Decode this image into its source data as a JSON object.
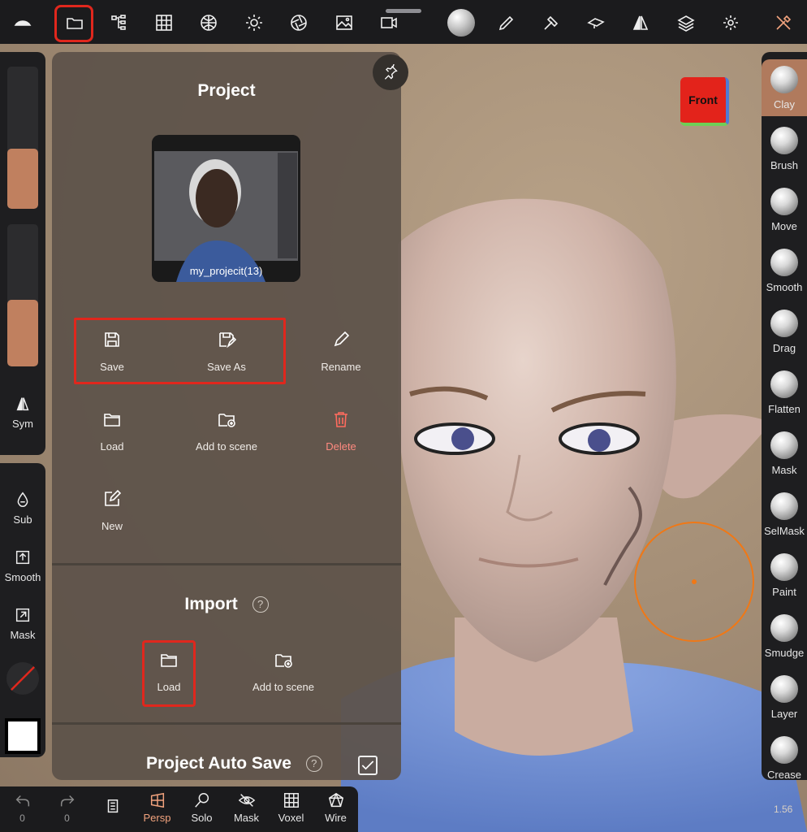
{
  "topbar": {
    "icons": [
      "cloud-icon",
      "folder-icon",
      "scene-tree-icon",
      "grid-icon",
      "sphere-grid-icon",
      "sun-icon",
      "aperture-icon",
      "image-icon",
      "video-icon",
      "material-ball-icon",
      "pen-icon",
      "hammer-icon",
      "plane-icon",
      "symmetry-icon",
      "layers-icon",
      "settings-icon",
      "tools-icon"
    ]
  },
  "panel": {
    "title": "Project",
    "thumbnail_caption": "my_projecit(13)",
    "actions": {
      "save": "Save",
      "save_as": "Save As",
      "rename": "Rename",
      "load": "Load",
      "add_to_scene": "Add to scene",
      "delete": "Delete",
      "new": "New"
    },
    "import": {
      "title": "Import",
      "help": "?",
      "load": "Load",
      "add_to_scene": "Add to scene"
    },
    "auto_save": {
      "title": "Project Auto Save",
      "help": "?",
      "checked": true
    }
  },
  "left": {
    "sym": "Sym",
    "sub": "Sub",
    "smooth": "Smooth",
    "mask": "Mask",
    "sliders": [
      0.42,
      0.47
    ]
  },
  "brushes": [
    {
      "label": "Clay",
      "active": true
    },
    {
      "label": "Brush"
    },
    {
      "label": "Move"
    },
    {
      "label": "Smooth"
    },
    {
      "label": "Drag"
    },
    {
      "label": "Flatten"
    },
    {
      "label": "Mask"
    },
    {
      "label": "SelMask"
    },
    {
      "label": "Paint"
    },
    {
      "label": "Smudge"
    },
    {
      "label": "Layer"
    },
    {
      "label": "Crease"
    }
  ],
  "bottombar": {
    "undo_count": "0",
    "redo_count": "0",
    "persp": "Persp",
    "solo": "Solo",
    "mask": "Mask",
    "voxel": "Voxel",
    "wire": "Wire"
  },
  "viewport": {
    "cube_label": "Front",
    "version": "1.56"
  },
  "colors": {
    "accent": "#c0805f",
    "annotation_red": "#e0271d",
    "brush_cursor": "#f07816",
    "delete": "#ff8a80"
  }
}
